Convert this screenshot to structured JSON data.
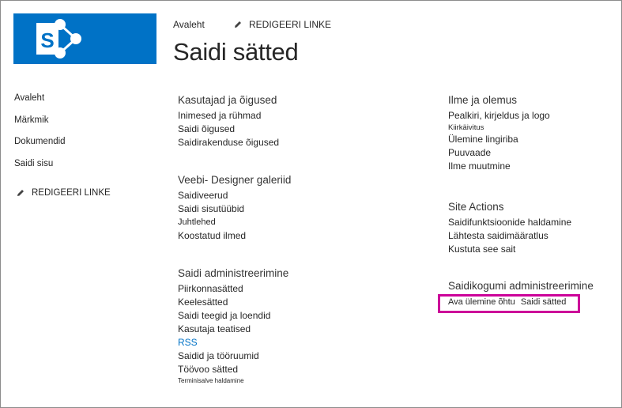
{
  "header": {
    "title": "Saidi sätted",
    "home_link": "Avaleht",
    "edit_links": "REDIGEERI LINKE",
    "logo_letter": "S"
  },
  "left_nav": {
    "items": [
      {
        "label": "Avaleht"
      },
      {
        "label": "Märkmik"
      },
      {
        "label": "Dokumendid"
      },
      {
        "label": "Saidi sisu"
      }
    ],
    "edit_links": "REDIGEERI LINKE"
  },
  "groups": {
    "users": {
      "title": "Kasutajad ja õigused",
      "links": [
        "Inimesed ja rühmad",
        "Saidi õigused",
        "Saidirakenduse õigused"
      ]
    },
    "galleries": {
      "title": "Veebi- Designer galeriid",
      "links": [
        "Saidiveerud",
        "Saidi sisutüübid",
        "Juhtlehed",
        "Koostatud ilmed"
      ]
    },
    "admin": {
      "title": "Saidi administreerimine",
      "links": [
        "Piirkonnasätted",
        "Keelesätted",
        "Saidi teegid ja loendid",
        "Kasutaja teatised",
        "RSS",
        "Saidid ja tööruumid",
        "Töövoo sätted",
        "Terminisalve haldamine"
      ]
    },
    "look": {
      "title": "Ilme ja olemus",
      "links": [
        "Pealkiri, kirjeldus ja logo",
        "Kiirkäivitus",
        "Ülemine lingiriba",
        "Puuvaade",
        "Ilme muutmine"
      ]
    },
    "actions": {
      "title": "Site Actions",
      "links": [
        "Saidifunktsioonide haldamine",
        "Lähtesta saidimääratlus",
        "Kustuta see sait"
      ]
    },
    "collection": {
      "title": "Saidikogumi administreerimine",
      "links": [
        "Ava ülemine õhtu",
        "Saidi sätted"
      ]
    }
  },
  "colors": {
    "brand_blue": "#0072c6",
    "highlight": "#cc0099",
    "link_blue": "#0072c6"
  }
}
